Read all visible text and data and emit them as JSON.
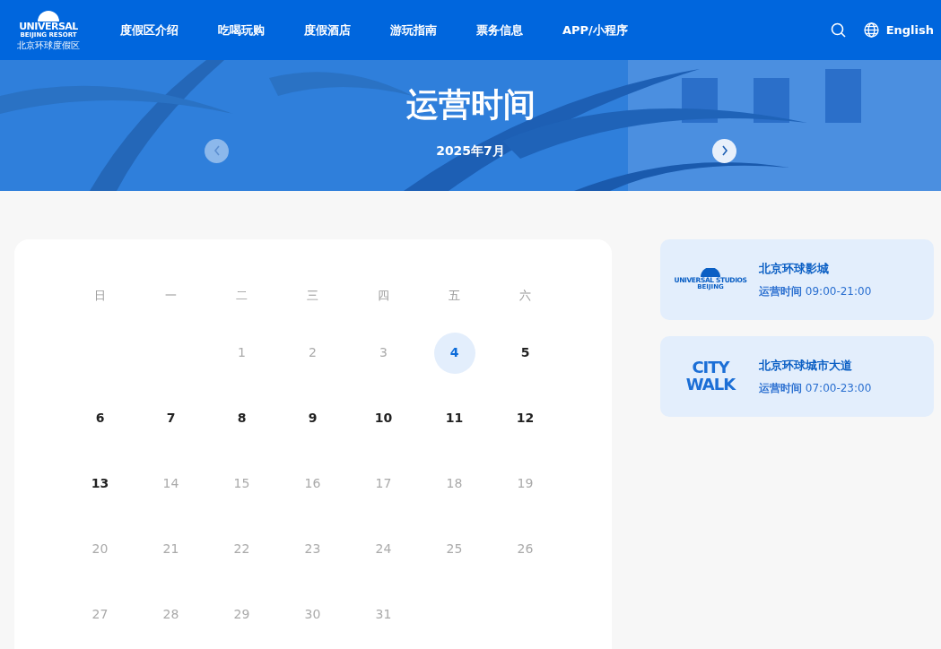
{
  "header": {
    "logo": {
      "wordmark": "UNIVERSAL",
      "subline": "BEIJING RESORT",
      "caption": "北京环球度假区"
    },
    "nav": [
      {
        "label": "度假区介绍"
      },
      {
        "label": "吃喝玩购"
      },
      {
        "label": "度假酒店"
      },
      {
        "label": "游玩指南"
      },
      {
        "label": "票务信息"
      },
      {
        "label": "APP/小程序"
      }
    ],
    "language": "English"
  },
  "hero": {
    "title": "运营时间",
    "month": "2025年7月",
    "prev_disabled": true,
    "next_disabled": false
  },
  "calendar": {
    "weekdays": [
      "日",
      "一",
      "二",
      "三",
      "四",
      "五",
      "六"
    ],
    "weeks": [
      {
        "days": [
          {
            "label": "1",
            "available": false,
            "selected": false
          },
          {
            "label": "2",
            "available": false,
            "selected": false
          },
          {
            "label": "3",
            "available": false,
            "selected": false
          },
          {
            "label": "4",
            "available": true,
            "selected": true
          },
          {
            "label": "5",
            "available": true,
            "selected": false
          }
        ]
      },
      {
        "days": [
          {
            "label": "6",
            "available": true,
            "selected": false
          },
          {
            "label": "7",
            "available": true,
            "selected": false
          },
          {
            "label": "8",
            "available": true,
            "selected": false
          },
          {
            "label": "9",
            "available": true,
            "selected": false
          },
          {
            "label": "10",
            "available": true,
            "selected": false
          },
          {
            "label": "11",
            "available": true,
            "selected": false
          },
          {
            "label": "12",
            "available": true,
            "selected": false
          }
        ]
      },
      {
        "days": [
          {
            "label": "13",
            "available": true,
            "selected": false
          },
          {
            "label": "14",
            "available": false,
            "selected": false
          },
          {
            "label": "15",
            "available": false,
            "selected": false
          },
          {
            "label": "16",
            "available": false,
            "selected": false
          },
          {
            "label": "17",
            "available": false,
            "selected": false
          },
          {
            "label": "18",
            "available": false,
            "selected": false
          },
          {
            "label": "19",
            "available": false,
            "selected": false
          }
        ]
      },
      {
        "days": [
          {
            "label": "20",
            "available": false,
            "selected": false
          },
          {
            "label": "21",
            "available": false,
            "selected": false
          },
          {
            "label": "22",
            "available": false,
            "selected": false
          },
          {
            "label": "23",
            "available": false,
            "selected": false
          },
          {
            "label": "24",
            "available": false,
            "selected": false
          },
          {
            "label": "25",
            "available": false,
            "selected": false
          },
          {
            "label": "26",
            "available": false,
            "selected": false
          }
        ]
      },
      {
        "days": [
          {
            "label": "27",
            "available": false,
            "selected": false
          },
          {
            "label": "28",
            "available": false,
            "selected": false
          },
          {
            "label": "29",
            "available": false,
            "selected": false
          },
          {
            "label": "30",
            "available": false,
            "selected": false
          },
          {
            "label": "31",
            "available": false,
            "selected": false
          }
        ]
      }
    ]
  },
  "venues": [
    {
      "kind": "studios",
      "logo_lines": [
        "UNIVERSAL STUDIOS",
        "BEIJING"
      ],
      "name": "北京环球影城",
      "hours_label": "运营时间",
      "hours": "09:00-21:00"
    },
    {
      "kind": "citywalk",
      "logo_lines": [
        "CITY",
        "WALK"
      ],
      "name": "北京环球城市大道",
      "hours_label": "运营时间",
      "hours": "07:00-23:00"
    }
  ]
}
